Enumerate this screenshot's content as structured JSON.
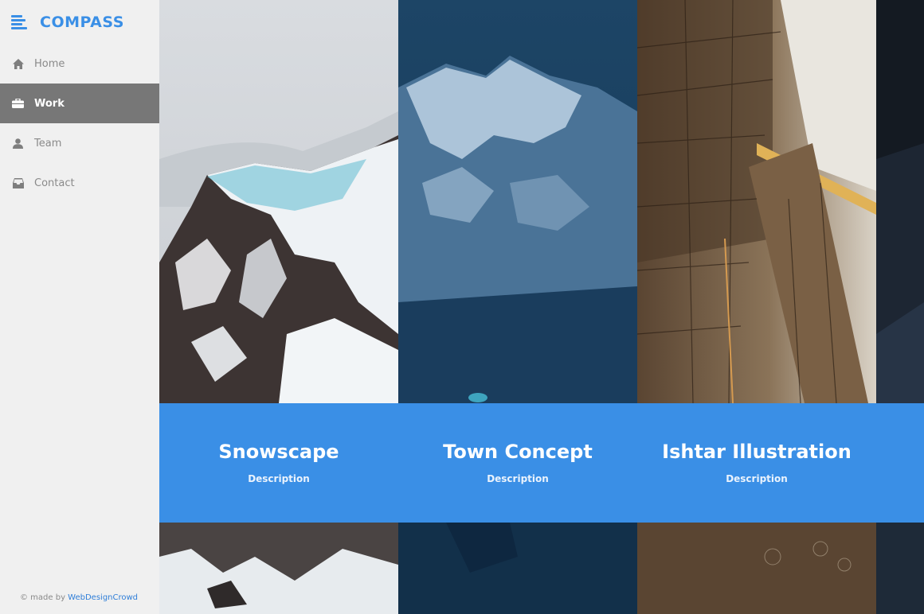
{
  "app": {
    "logo_text": "COMPASS"
  },
  "sidebar": {
    "items": [
      {
        "label": "Home",
        "icon": "home-icon",
        "active": false
      },
      {
        "label": "Work",
        "icon": "briefcase-icon",
        "active": true
      },
      {
        "label": "Team",
        "icon": "user-icon",
        "active": false
      },
      {
        "label": "Contact",
        "icon": "inbox-icon",
        "active": false
      }
    ],
    "credit_prefix": "© made by ",
    "credit_link": "WebDesignCrowd"
  },
  "gallery": {
    "items": [
      {
        "title": "Snowscape",
        "description": "Description"
      },
      {
        "title": "Town Concept",
        "description": "Description"
      },
      {
        "title": "Ishtar Illustration",
        "description": "Description"
      }
    ]
  },
  "colors": {
    "accent": "#3a8fe6",
    "sidebar_bg": "#f0f0f0",
    "active_item_bg": "#777777",
    "link": "#2f7ed8"
  }
}
